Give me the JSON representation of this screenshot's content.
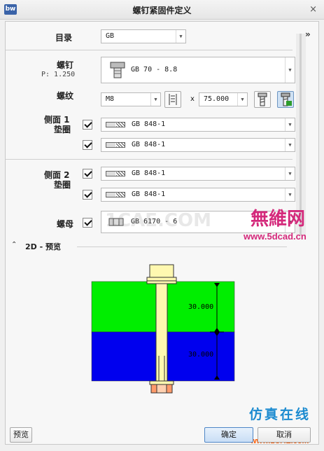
{
  "window": {
    "title": "螺钉紧固件定义",
    "app_badge": "bw",
    "close_glyph": "×",
    "expand_glyph": "»"
  },
  "catalog": {
    "label": "目录",
    "value": "GB"
  },
  "screw": {
    "label": "螺钉",
    "pitch": "P: 1.250",
    "value": "GB 70 - 8.8"
  },
  "thread": {
    "label": "螺纹",
    "size": "M8",
    "times": "x",
    "length": "75.000"
  },
  "side1": {
    "label_line1": "侧面 1",
    "label_line2": "垫圈",
    "washers": [
      {
        "checked": true,
        "value": "GB 848-1"
      },
      {
        "checked": true,
        "value": "GB 848-1"
      }
    ]
  },
  "side2": {
    "label_line1": "侧面 2",
    "label_line2": "垫圈",
    "washers": [
      {
        "checked": true,
        "value": "GB 848-1"
      },
      {
        "checked": true,
        "value": "GB 848-1"
      }
    ]
  },
  "nut": {
    "label": "螺母",
    "checked": true,
    "value": "GB 6170 - 6"
  },
  "preview": {
    "header": "2D - 预览",
    "collapse_glyph": "≈",
    "dim_top": "30.000",
    "dim_bottom": "30.000",
    "colors": {
      "plate_top": "#00ee00",
      "plate_bottom": "#0000ee",
      "bolt": "#fff8b0",
      "nut": "#ff9a6a"
    }
  },
  "footer": {
    "preview_button": "预览",
    "ok_button": "确定",
    "cancel_button": "取消"
  },
  "watermarks": {
    "brand_top": "無維网",
    "site_top": "www.5dcad.cn",
    "faint": "1CAE.COM",
    "brand_bottom": "仿真在线",
    "site_bottom": "www.1CAE.com"
  }
}
